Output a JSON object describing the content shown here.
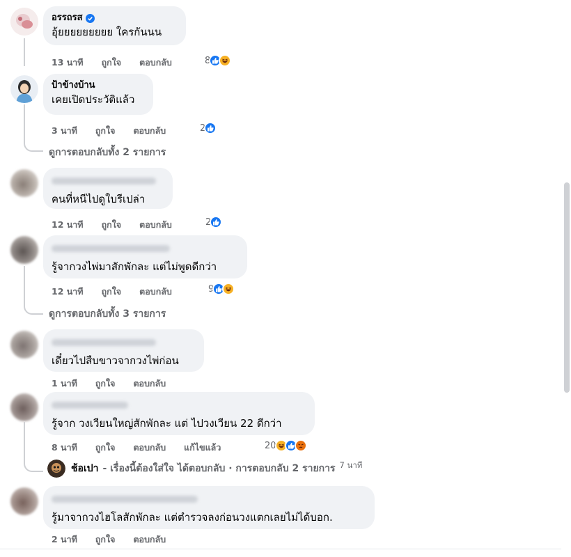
{
  "actions": {
    "like": "ถูกใจ",
    "reply": "ตอบกลับ",
    "edited": "แก้ไขแล้ว"
  },
  "comments": [
    {
      "name": "อรรถรส",
      "verified": true,
      "text": "อุ้ยยยยยยยยย ใครกันนน",
      "time": "13 นาที",
      "reactions": "8",
      "reaction_icons": [
        "like-icon",
        "haha-icon"
      ]
    },
    {
      "name": "ป้าข้างบ้าน",
      "text": "เคยเปิดประวัติแล้ว",
      "time": "3 นาที",
      "reactions": "2",
      "reaction_icons": [
        "like-icon"
      ]
    },
    {
      "text": "คนที่หนีไปดูใบรีเปล่า",
      "time": "12 นาที",
      "reactions": "2",
      "reaction_icons": [
        "like-icon"
      ]
    },
    {
      "text": "รู้จากวงไพ่มาสักพักละ แต่ไม่พูดดีกว่า",
      "time": "12 นาที",
      "reactions": "9",
      "reaction_icons": [
        "like-icon",
        "haha-icon"
      ]
    },
    {
      "text": "เดี๋ยวไปสืบขาวจากวงไพ่ก่อน",
      "time": "1 นาที"
    },
    {
      "text": "รู้จาก วงเวียนใหญ่สักพักละ แต่ ไปวงเวียน 22 ดีกว่า",
      "time": "8 นาที",
      "reactions": "20",
      "reaction_icons": [
        "haha-icon",
        "like-icon",
        "angry-icon"
      ]
    },
    {
      "text": "รู้มาจากวงไฮโลสักพักละ แต่ตำรวจลงก่อนวงแตกเลยไม่ได้บอก.",
      "time": "2 นาที"
    }
  ],
  "view_replies_1": "ดูการตอบกลับทั้ง 2 รายการ",
  "view_replies_2": "ดูการตอบกลับทั้ง 3 รายการ",
  "reply_preview": {
    "name": "ช้อเปา",
    "text": "- เรื่องนี้ต้องใส่ใจ ได้ตอบกลับ · การตอบกลับ 2 รายการ",
    "time": "7 นาที"
  },
  "colors": {
    "like": "#1877f2",
    "haha": "#f7b125",
    "angry": "#e9710f",
    "bubble": "#f0f2f5",
    "meta": "#65676b"
  }
}
